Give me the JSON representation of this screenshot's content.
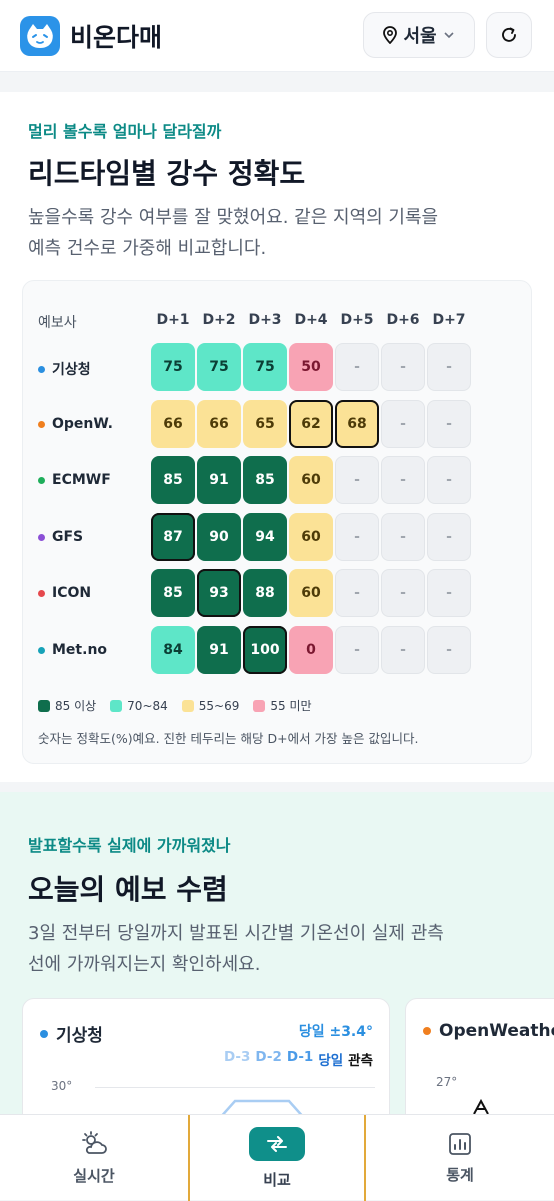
{
  "header": {
    "app_title": "비온다매",
    "location": "서울"
  },
  "section1": {
    "eyebrow": "멀리 볼수록 얼마나 달라질까",
    "title": "리드타임별 강수 정확도",
    "desc_line1": "높을수록 강수 여부를 잘 맞혔어요. 같은 지역의 기록을",
    "desc_line2": "예측 건수로 가중해 비교합니다."
  },
  "table": {
    "provider_header": "예보사",
    "columns": [
      "D+1",
      "D+2",
      "D+3",
      "D+4",
      "D+5",
      "D+6",
      "D+7"
    ],
    "rows": [
      {
        "name": "기상청",
        "dot": "#2b8fe0",
        "cells": [
          {
            "v": "75",
            "c": "mint"
          },
          {
            "v": "75",
            "c": "mint"
          },
          {
            "v": "75",
            "c": "mint"
          },
          {
            "v": "50",
            "c": "pink"
          },
          {
            "v": "-",
            "c": "empty"
          },
          {
            "v": "-",
            "c": "empty"
          },
          {
            "v": "-",
            "c": "empty"
          }
        ]
      },
      {
        "name": "OpenW.",
        "dot": "#f07f1f",
        "cells": [
          {
            "v": "66",
            "c": "yellow"
          },
          {
            "v": "66",
            "c": "yellow"
          },
          {
            "v": "65",
            "c": "yellow"
          },
          {
            "v": "62",
            "c": "yellow",
            "best": true
          },
          {
            "v": "68",
            "c": "yellow",
            "best": true
          },
          {
            "v": "-",
            "c": "empty"
          },
          {
            "v": "-",
            "c": "empty"
          }
        ]
      },
      {
        "name": "ECMWF",
        "dot": "#1fae5b",
        "cells": [
          {
            "v": "85",
            "c": "dark"
          },
          {
            "v": "91",
            "c": "dark"
          },
          {
            "v": "85",
            "c": "dark"
          },
          {
            "v": "60",
            "c": "yellow"
          },
          {
            "v": "-",
            "c": "empty"
          },
          {
            "v": "-",
            "c": "empty"
          },
          {
            "v": "-",
            "c": "empty"
          }
        ]
      },
      {
        "name": "GFS",
        "dot": "#8b4fd6",
        "cells": [
          {
            "v": "87",
            "c": "dark",
            "best": true
          },
          {
            "v": "90",
            "c": "dark"
          },
          {
            "v": "94",
            "c": "dark"
          },
          {
            "v": "60",
            "c": "yellow"
          },
          {
            "v": "-",
            "c": "empty"
          },
          {
            "v": "-",
            "c": "empty"
          },
          {
            "v": "-",
            "c": "empty"
          }
        ]
      },
      {
        "name": "ICON",
        "dot": "#e5484d",
        "cells": [
          {
            "v": "85",
            "c": "dark"
          },
          {
            "v": "93",
            "c": "dark",
            "best": true
          },
          {
            "v": "88",
            "c": "dark"
          },
          {
            "v": "60",
            "c": "yellow"
          },
          {
            "v": "-",
            "c": "empty"
          },
          {
            "v": "-",
            "c": "empty"
          },
          {
            "v": "-",
            "c": "empty"
          }
        ]
      },
      {
        "name": "Met.no",
        "dot": "#17a2b8",
        "cells": [
          {
            "v": "84",
            "c": "mint"
          },
          {
            "v": "91",
            "c": "dark"
          },
          {
            "v": "100",
            "c": "dark",
            "best": true
          },
          {
            "v": "0",
            "c": "pink"
          },
          {
            "v": "-",
            "c": "empty"
          },
          {
            "v": "-",
            "c": "empty"
          },
          {
            "v": "-",
            "c": "empty"
          }
        ]
      }
    ],
    "legend": [
      {
        "label": "85 이상",
        "color": "#0f6e4d"
      },
      {
        "label": "70~84",
        "color": "#5ee6c8"
      },
      {
        "label": "55~69",
        "color": "#fbe296"
      },
      {
        "label": "55 미만",
        "color": "#f8a3b4"
      }
    ],
    "note": "숫자는 정확도(%)예요. 진한 테두리는 해당 D+에서 가장 높은 값입니다."
  },
  "section2": {
    "eyebrow": "발표할수록 실제에 가까워졌나",
    "title": "오늘의 예보 수렴",
    "desc_line1": "3일 전부터 당일까지 발표된 시간별 기온선이 실제 관측",
    "desc_line2": "선에 가까워지는지 확인하세요."
  },
  "convergence_cards": [
    {
      "name": "기상청",
      "dot": "#2b8fe0",
      "delta": "당일 ±3.4°",
      "legend": [
        "D-3",
        "D-2",
        "D-1",
        "당일",
        "관측"
      ],
      "ytick": "30°"
    },
    {
      "name": "OpenWeathe",
      "dot": "#f07f1f",
      "ytick": "27°"
    }
  ],
  "nav": [
    {
      "label": "실시간",
      "icon": "sun-cloud-icon"
    },
    {
      "label": "비교",
      "icon": "compare-icon",
      "active": true
    },
    {
      "label": "통계",
      "icon": "chart-icon"
    }
  ]
}
